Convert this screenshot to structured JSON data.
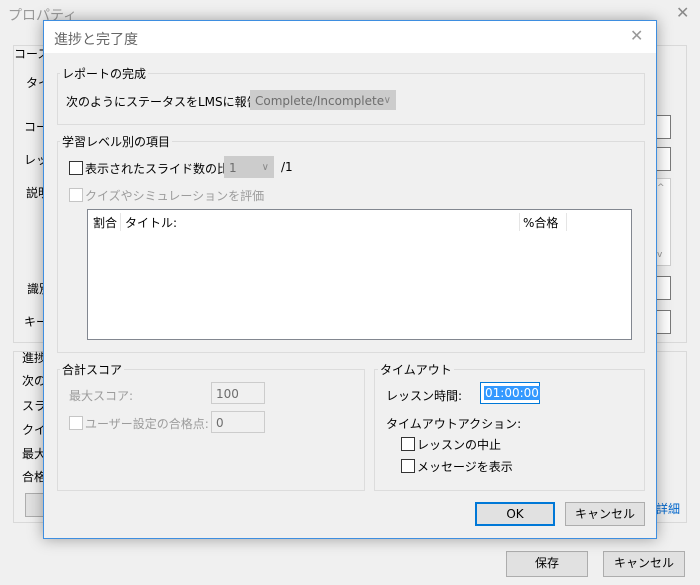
{
  "background": {
    "title": "プロパティ",
    "course_label": "コース",
    "left_labels": [
      "タイ",
      "コー",
      "レッ",
      "説明",
      "識別",
      "キー"
    ],
    "progress_label": "進捗",
    "progress_lines": [
      "次の",
      "スラ",
      "クイ",
      "最大",
      "合格"
    ],
    "detail_link": "詳細",
    "save_button": "保存",
    "cancel_button": "キャンセル"
  },
  "dialog": {
    "title": "進捗と完了度",
    "report": {
      "group_label": "レポートの完成",
      "status_label": "次のようにステータスをLMSに報告する:",
      "status_value": "Complete/Incomplete"
    },
    "learning": {
      "group_label": "学習レベル別の項目",
      "slides_ratio_label": "表示されたスライド数の比率:",
      "slides_ratio_value": "1",
      "slides_total": "/1",
      "evaluate_quiz_label": "クイズやシミュレーションを評価",
      "table_headers": {
        "ratio": "割合",
        "title": "タイトル:",
        "pass": "%合格"
      }
    },
    "score": {
      "group_label": "合計スコア",
      "max_score_label": "最大スコア:",
      "max_score_value": "100",
      "custom_pass_label": "ユーザー設定の合格点:",
      "custom_pass_value": "0"
    },
    "timeout": {
      "group_label": "タイムアウト",
      "lesson_time_label": "レッスン時間:",
      "lesson_time_value": "01:00:00",
      "action_label": "タイムアウトアクション:",
      "abort_label": "レッスンの中止",
      "show_message_label": "メッセージを表示"
    },
    "ok_button": "OK",
    "cancel_button": "キャンセル"
  },
  "colors": {
    "accent": "#0078d7",
    "selection": "#3399ff",
    "border_focus": "#3e8ee0"
  }
}
